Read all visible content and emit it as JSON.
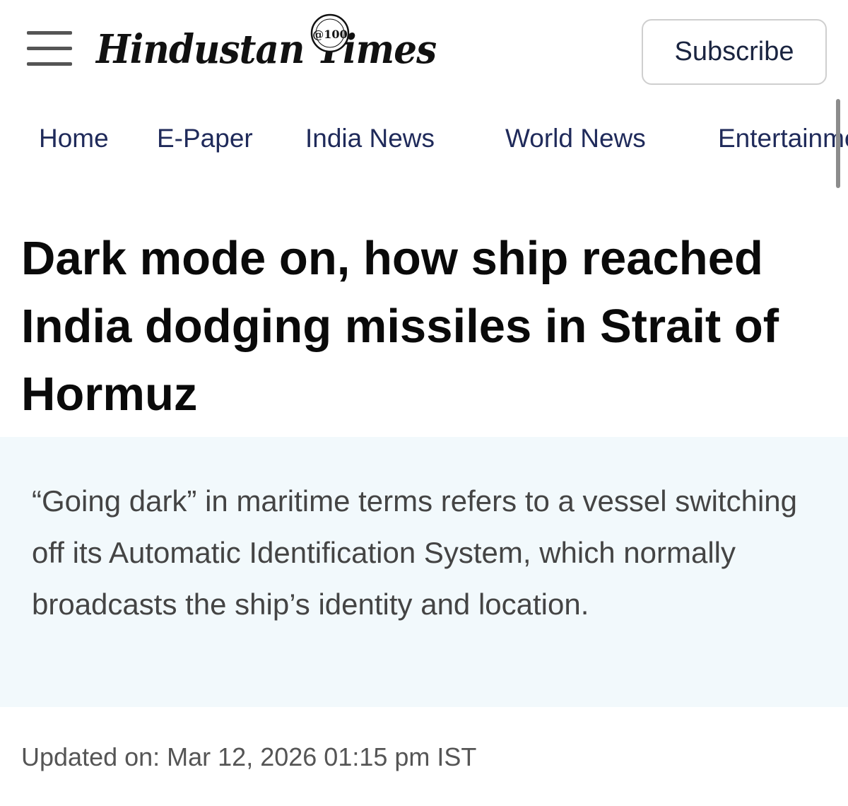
{
  "header": {
    "logo_text": "Hindustan Times",
    "logo_badge": "@100",
    "subscribe_label": "Subscribe"
  },
  "nav": {
    "items": [
      {
        "label": "Home"
      },
      {
        "label": "E-Paper"
      },
      {
        "label": "India News"
      },
      {
        "label": "World News"
      },
      {
        "label": "Entertainment"
      }
    ]
  },
  "article": {
    "headline": "Dark mode on, how ship reached India dodging missiles in Strait of Hormuz",
    "summary": "“Going dark” in maritime terms refers to a vessel switching off its Automatic Identification System, which normally broadcasts the ship’s identity and location.",
    "updated": "Updated on: Mar 12, 2026 01:15 pm IST"
  }
}
